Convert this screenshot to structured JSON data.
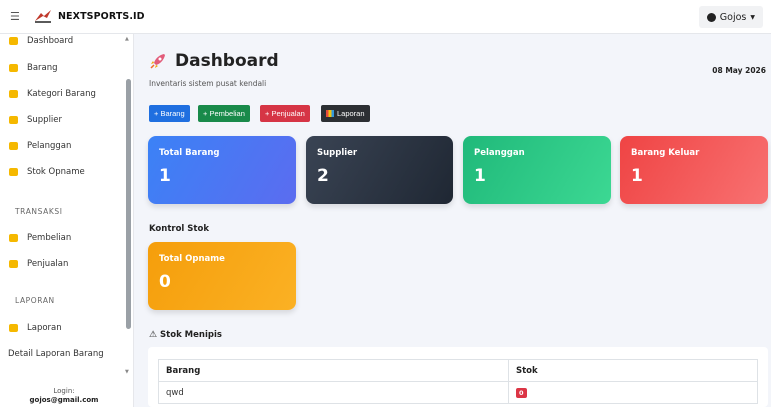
{
  "topbar": {
    "brand": "NEXTSPORTS.ID",
    "user": "Gojos"
  },
  "sidebar": {
    "items": [
      {
        "label": "Dashboard",
        "color": "#f5b800"
      },
      {
        "label": "Barang",
        "color": "#f5b800"
      },
      {
        "label": "Kategori Barang",
        "color": "#f5b800"
      },
      {
        "label": "Supplier",
        "color": "#f5b800"
      },
      {
        "label": "Pelanggan",
        "color": "#f5b800"
      },
      {
        "label": "Stok Opname",
        "color": "#f5b800"
      }
    ],
    "section_transaksi": "TRANSAKSI",
    "transaksi_items": [
      {
        "label": "Pembelian",
        "color": "#f5b800"
      },
      {
        "label": "Penjualan",
        "color": "#f5b800"
      }
    ],
    "section_laporan": "LAPORAN",
    "laporan_item": "Laporan",
    "detail_laporan": "Detail Laporan Barang",
    "login_label": "Login:",
    "login_email": "gojos@gmail.com"
  },
  "main": {
    "title": "Dashboard",
    "subtitle": "Inventaris sistem pusat kendali",
    "date": "08 May 2026",
    "buttons": {
      "barang": "+ Barang",
      "pembelian": "+ Pembelian",
      "penjualan": "+ Penjualan",
      "laporan": "Laporan"
    },
    "cards": [
      {
        "label": "Total Barang",
        "value": "1"
      },
      {
        "label": "Supplier",
        "value": "2"
      },
      {
        "label": "Pelanggan",
        "value": "1"
      },
      {
        "label": "Barang Keluar",
        "value": "1"
      }
    ],
    "kontrol_title": "Kontrol Stok",
    "opname_card": {
      "label": "Total Opname",
      "value": "0"
    },
    "stok_title": "Stok Menipis",
    "table": {
      "headers": [
        "Barang",
        "Stok"
      ],
      "rows": [
        {
          "barang": "qwd",
          "stok": "0"
        }
      ]
    }
  }
}
